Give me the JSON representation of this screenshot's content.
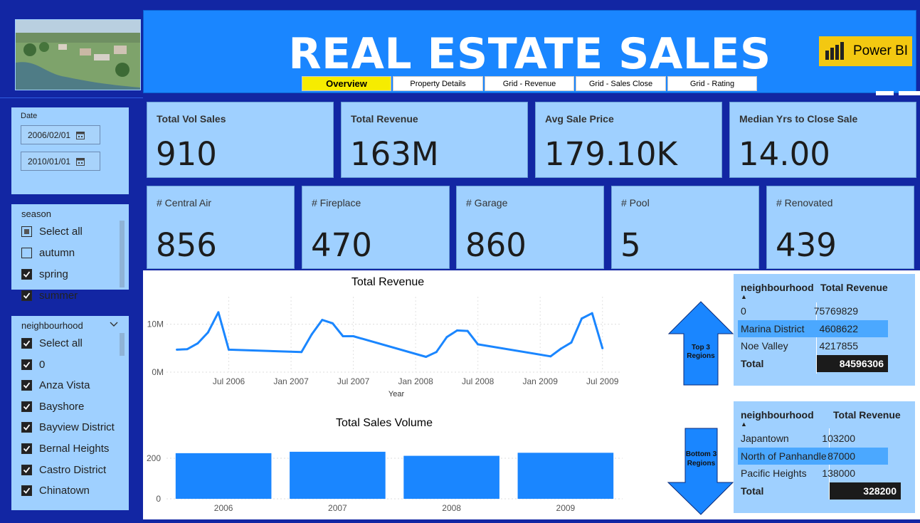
{
  "header": {
    "title": "REAL ESTATE SALES",
    "logo_text": "Power BI",
    "tabs": [
      "Overview",
      "Property Details",
      "Grid - Revenue",
      "Grid - Sales Close",
      "Grid - Rating"
    ],
    "active_tab": "Overview"
  },
  "date_slicer": {
    "label": "Date",
    "start": "2006/02/01",
    "end": "2010/01/01"
  },
  "season_slicer": {
    "title": "season",
    "items": [
      {
        "label": "Select all",
        "state": "partial"
      },
      {
        "label": "autumn",
        "state": "unchecked"
      },
      {
        "label": "spring",
        "state": "checked"
      },
      {
        "label": "summer",
        "state": "checked"
      }
    ]
  },
  "neighbourhood_slicer": {
    "title": "neighbourhood",
    "items": [
      {
        "label": "Select all",
        "state": "checked"
      },
      {
        "label": "0",
        "state": "checked"
      },
      {
        "label": "Anza Vista",
        "state": "checked"
      },
      {
        "label": "Bayshore",
        "state": "checked"
      },
      {
        "label": "Bayview District",
        "state": "checked"
      },
      {
        "label": "Bernal Heights",
        "state": "checked"
      },
      {
        "label": "Castro District",
        "state": "checked"
      },
      {
        "label": "Chinatown",
        "state": "checked"
      }
    ]
  },
  "kpis_top": [
    {
      "label": "Total Vol Sales",
      "value": "910"
    },
    {
      "label": "Total Revenue",
      "value": "163M"
    },
    {
      "label": "Avg Sale Price",
      "value": "179.10K"
    },
    {
      "label": "Median Yrs to Close Sale",
      "value": "14.00"
    }
  ],
  "kpis_bottom": [
    {
      "label": "# Central Air",
      "value": "856"
    },
    {
      "label": "# Fireplace",
      "value": "470"
    },
    {
      "label": "# Garage",
      "value": "860"
    },
    {
      "label": "# Pool",
      "value": "5"
    },
    {
      "label": "# Renovated",
      "value": "439"
    }
  ],
  "arrows": {
    "top": "Top 3 Regions",
    "bottom": "Bottom 3 Regions"
  },
  "top_table": {
    "col1": "neighbourhood",
    "col2": "Total Revenue",
    "rows": [
      {
        "name": "0",
        "value": "75769829"
      },
      {
        "name": "Marina District",
        "value": "4608622"
      },
      {
        "name": "Noe Valley",
        "value": "4217855"
      }
    ],
    "total_label": "Total",
    "total_value": "84596306"
  },
  "bottom_table": {
    "col1": "neighbourhood",
    "col2": "Total Revenue",
    "rows": [
      {
        "name": "Japantown",
        "value": "103200"
      },
      {
        "name": "North of Panhandle",
        "value": "87000"
      },
      {
        "name": "Pacific Heights",
        "value": "138000"
      }
    ],
    "total_label": "Total",
    "total_value": "328200"
  },
  "colors": {
    "background": "#1226a3",
    "banner": "#1a86ff",
    "panel": "#9fd0ff",
    "series": "#1a86ff",
    "active_tab": "#f6ec00",
    "logo": "#f3c811"
  },
  "chart_data": [
    {
      "type": "line",
      "title": "Total Revenue",
      "xlabel": "Year",
      "ylabel": "",
      "x_ticks": [
        "Jul 2006",
        "Jan 2007",
        "Jul 2007",
        "Jan 2008",
        "Jul 2008",
        "Jan 2009",
        "Jul 2009"
      ],
      "y_ticks": [
        "0M",
        "10M"
      ],
      "ylim": [
        0,
        15
      ],
      "y_unit": "M",
      "x": [
        "2006-02",
        "2006-03",
        "2006-04",
        "2006-05",
        "2006-06",
        "2006-07",
        "2007-02",
        "2007-03",
        "2007-04",
        "2007-05",
        "2007-06",
        "2007-07",
        "2008-02",
        "2008-03",
        "2008-04",
        "2008-05",
        "2008-06",
        "2008-07",
        "2009-02",
        "2009-03",
        "2009-04",
        "2009-05",
        "2009-06",
        "2009-07"
      ],
      "values": [
        4.7,
        4.8,
        6.0,
        8.3,
        12.5,
        4.7,
        4.2,
        7.9,
        10.9,
        10.2,
        7.5,
        7.5,
        3.2,
        4.2,
        7.3,
        8.7,
        8.6,
        5.8,
        3.3,
        4.9,
        6.2,
        11.2,
        12.3,
        5.0
      ]
    },
    {
      "type": "bar",
      "title": "Total Sales Volume",
      "xlabel": "",
      "ylabel": "",
      "categories": [
        "2006",
        "2007",
        "2008",
        "2009"
      ],
      "values": [
        225,
        232,
        212,
        227
      ],
      "y_ticks": [
        "0",
        "200"
      ],
      "ylim": [
        0,
        280
      ]
    }
  ]
}
